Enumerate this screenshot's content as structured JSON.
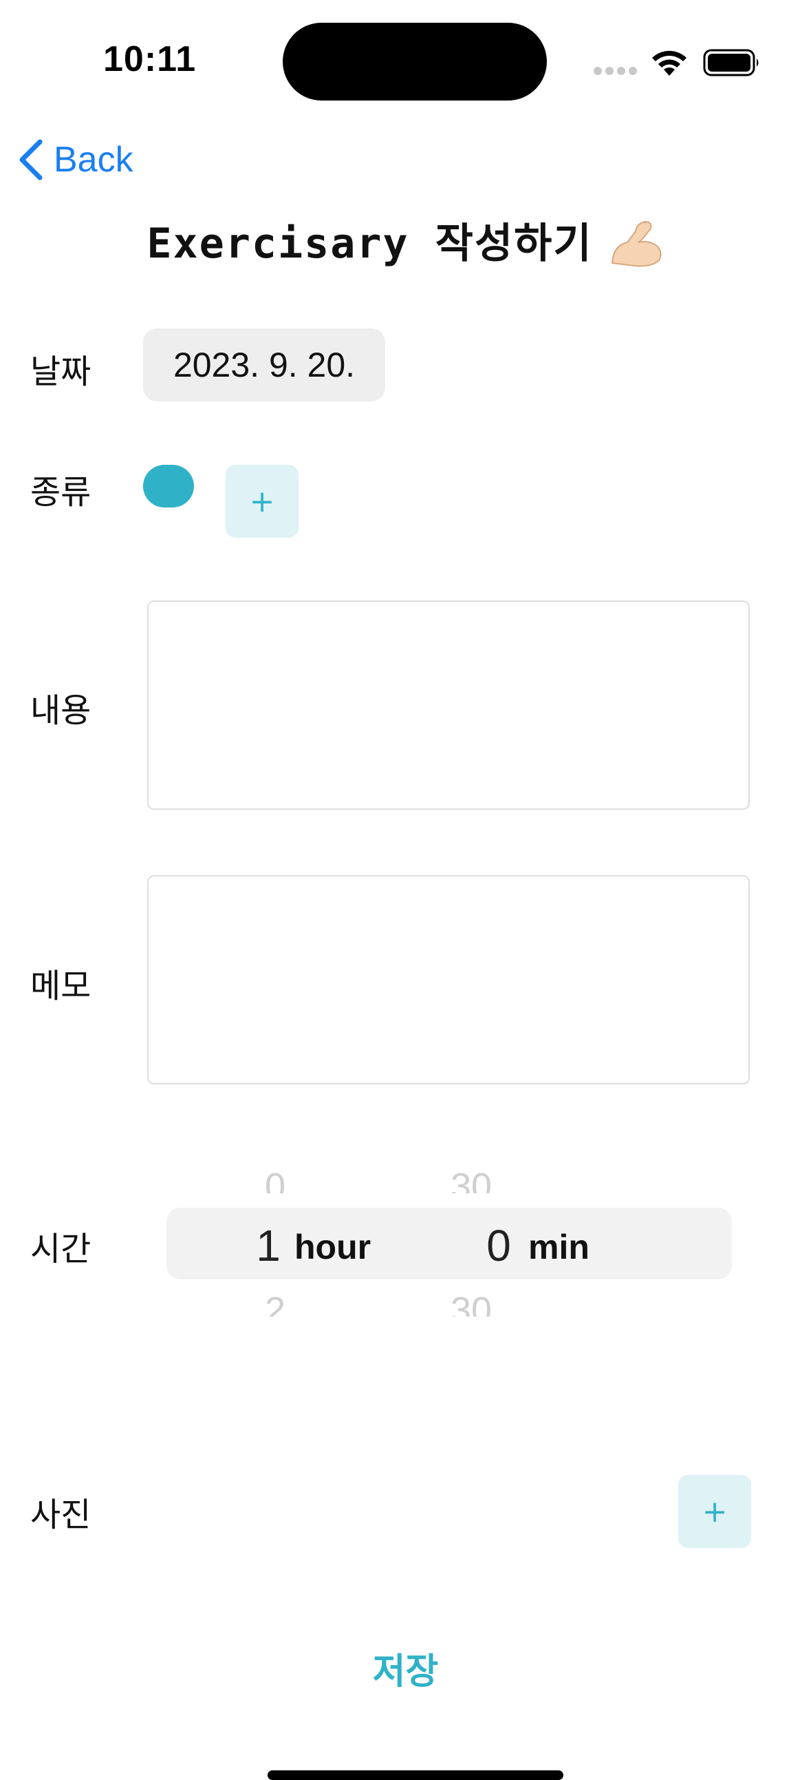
{
  "status_bar": {
    "time": "10:11"
  },
  "nav": {
    "back_label": "Back"
  },
  "header": {
    "title": "Exercisary 작성하기"
  },
  "form": {
    "date": {
      "label": "날짜",
      "value": "2023. 9. 20."
    },
    "type": {
      "label": "종류",
      "add_label": "+",
      "chip_color": "#2fb2c8"
    },
    "content": {
      "label": "내용",
      "value": ""
    },
    "memo": {
      "label": "메모",
      "value": ""
    },
    "time": {
      "label": "시간",
      "hour_above": "0",
      "hour_selected": "1",
      "hour_below": "2",
      "hour_unit": "hour",
      "min_above": "30",
      "min_selected": "0",
      "min_below": "30",
      "min_unit": "min"
    },
    "photo": {
      "label": "사진",
      "add_label": "+"
    }
  },
  "footer": {
    "save_label": "저장"
  },
  "colors": {
    "accent": "#2fb2c8",
    "link": "#1a7ff0",
    "add_bg": "#dff2f6"
  }
}
